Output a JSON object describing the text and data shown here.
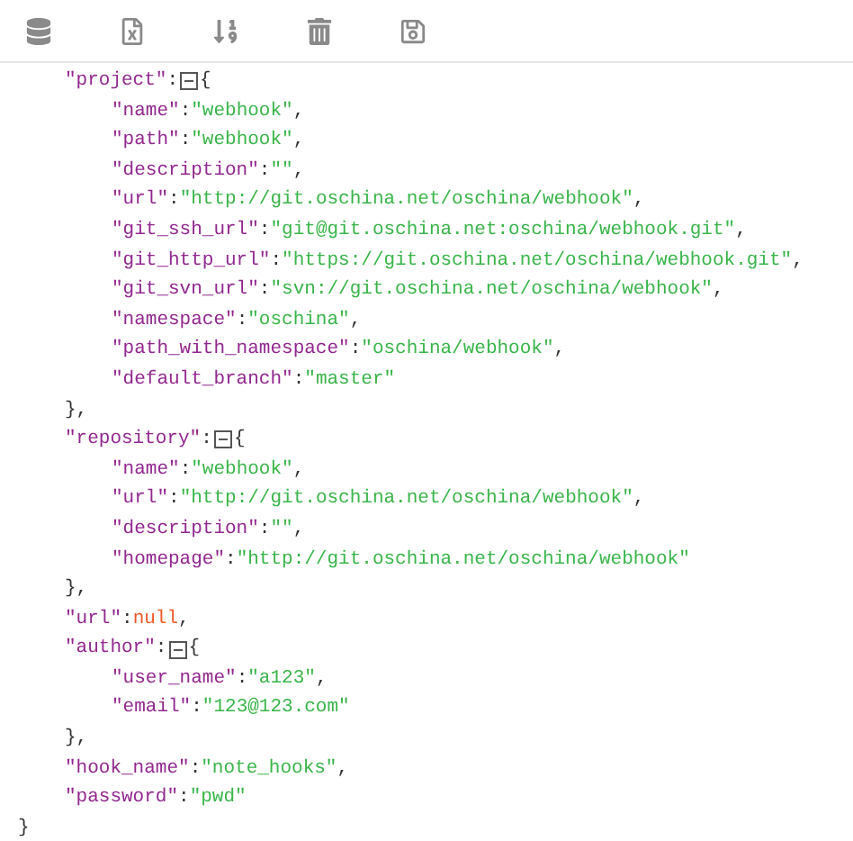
{
  "toolbar": [
    {
      "kind": "database"
    },
    {
      "kind": "excel"
    },
    {
      "kind": "sort"
    },
    {
      "kind": "trash"
    },
    {
      "kind": "save"
    }
  ],
  "root": {
    "close": "}",
    "children": [
      {
        "key": "\"project\"",
        "colon": ":",
        "kind": "object",
        "expanded": true,
        "open": "{",
        "close": "}",
        "comma": ",",
        "children": [
          {
            "key": "\"name\"",
            "colon": ":",
            "kind": "string",
            "value": "\"webhook\"",
            "comma": ","
          },
          {
            "key": "\"path\"",
            "colon": ":",
            "kind": "string",
            "value": "\"webhook\"",
            "comma": ","
          },
          {
            "key": "\"description\"",
            "colon": ":",
            "kind": "string",
            "value": "\"\"",
            "comma": ","
          },
          {
            "key": "\"url\"",
            "colon": ":",
            "kind": "string",
            "value": "\"http://git.oschina.net/oschina/webhook\"",
            "comma": ","
          },
          {
            "key": "\"git_ssh_url\"",
            "colon": ":",
            "kind": "string",
            "value": "\"git@git.oschina.net:oschina/webhook.git\"",
            "comma": ","
          },
          {
            "key": "\"git_http_url\"",
            "colon": ":",
            "kind": "string",
            "value": "\"https://git.oschina.net/oschina/webhook.git\"",
            "comma": ","
          },
          {
            "key": "\"git_svn_url\"",
            "colon": ":",
            "kind": "string",
            "value": "\"svn://git.oschina.net/oschina/webhook\"",
            "comma": ","
          },
          {
            "key": "\"namespace\"",
            "colon": ":",
            "kind": "string",
            "value": "\"oschina\"",
            "comma": ","
          },
          {
            "key": "\"path_with_namespace\"",
            "colon": ":",
            "kind": "string",
            "value": "\"oschina/webhook\"",
            "comma": ","
          },
          {
            "key": "\"default_branch\"",
            "colon": ":",
            "kind": "string",
            "value": "\"master\""
          }
        ]
      },
      {
        "key": "\"repository\"",
        "colon": ":",
        "kind": "object",
        "expanded": true,
        "open": "{",
        "close": "}",
        "comma": ",",
        "children": [
          {
            "key": "\"name\"",
            "colon": ":",
            "kind": "string",
            "value": "\"webhook\"",
            "comma": ","
          },
          {
            "key": "\"url\"",
            "colon": ":",
            "kind": "string",
            "value": "\"http://git.oschina.net/oschina/webhook\"",
            "comma": ","
          },
          {
            "key": "\"description\"",
            "colon": ":",
            "kind": "string",
            "value": "\"\"",
            "comma": ","
          },
          {
            "key": "\"homepage\"",
            "colon": ":",
            "kind": "string",
            "value": "\"http://git.oschina.net/oschina/webhook\""
          }
        ]
      },
      {
        "key": "\"url\"",
        "colon": ":",
        "kind": "null",
        "value": "null",
        "comma": ","
      },
      {
        "key": "\"author\"",
        "colon": ":",
        "kind": "object",
        "expanded": true,
        "open": "{",
        "close": "}",
        "comma": ",",
        "children": [
          {
            "key": "\"user_name\"",
            "colon": ":",
            "kind": "string",
            "value": "\"a123\"",
            "comma": ","
          },
          {
            "key": "\"email\"",
            "colon": ":",
            "kind": "string",
            "value": "\"123@123.com\""
          }
        ]
      },
      {
        "key": "\"hook_name\"",
        "colon": ":",
        "kind": "string",
        "value": "\"note_hooks\"",
        "comma": ","
      },
      {
        "key": "\"password\"",
        "colon": ":",
        "kind": "string",
        "value": "\"pwd\""
      }
    ]
  }
}
